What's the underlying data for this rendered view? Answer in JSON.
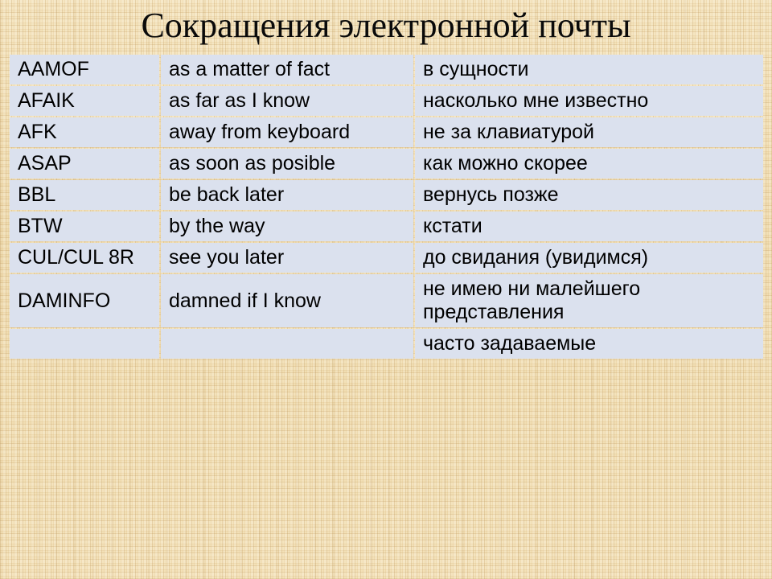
{
  "slide": {
    "title": "Сокращения электронной почты",
    "background_color": "#f2dfb4",
    "accent_color": "#4a7cbb",
    "cell_light_color": "#e9ecf5",
    "cell_mid_color": "#ccd5e6"
  },
  "table": {
    "rows": [
      {
        "abbr": "AAMOF",
        "english": "as a matter of fact",
        "russian": "в сущности",
        "style": "header"
      },
      {
        "abbr": "AFAIK",
        "english": "as far as I know",
        "russian": "насколько мне известно",
        "style": "mid"
      },
      {
        "abbr": "AFK",
        "english": "away from keyboard",
        "russian": "не за клавиатурой",
        "style": "light"
      },
      {
        "abbr": "ASAP",
        "english": "as soon as posible",
        "russian": "как можно скорее",
        "style": "mid"
      },
      {
        "abbr": "BBL",
        "english": "be back later",
        "russian": "вернусь позже",
        "style": "light"
      },
      {
        "abbr": "BTW",
        "english": "by the way",
        "russian": "кстати",
        "style": "mid"
      },
      {
        "abbr": "CUL/CUL 8R",
        "english": "see you later",
        "russian": "до свидания (увидимся)",
        "style": "light"
      },
      {
        "abbr": "DAMINFO",
        "english": "damned if I know",
        "russian": "не имею ни малейшего представления",
        "style": "mid"
      },
      {
        "abbr": "",
        "english": "",
        "russian": "часто задаваемые",
        "style": "light"
      }
    ]
  }
}
